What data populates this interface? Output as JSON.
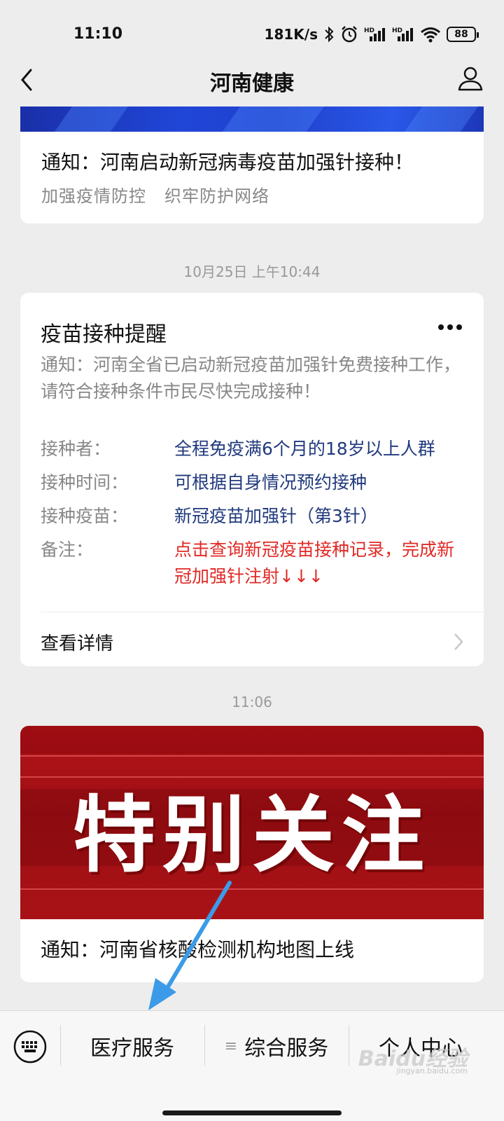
{
  "status_bar": {
    "time": "11:10",
    "network_speed": "181K/s",
    "battery": "88",
    "icons": [
      "bluetooth-icon",
      "alarm-icon",
      "hd-signal-icon",
      "hd-signal-icon",
      "wifi-icon",
      "battery-icon"
    ]
  },
  "header": {
    "title": "河南健康"
  },
  "card1": {
    "headline": "通知：河南启动新冠病毒疫苗加强针接种！",
    "sub1": "加强疫情防控",
    "sub2": "织牢防护网络"
  },
  "timestamp1": "10月25日 上午10:44",
  "card2": {
    "title": "疫苗接种提醒",
    "description": "通知：河南全省已启动新冠疫苗加强针免费接种工作，请符合接种条件市民尽快完成接种！",
    "fields": [
      {
        "label": "接种者：",
        "value": "全程免疫满6个月的18岁以上人群"
      },
      {
        "label": "接种时间：",
        "value": "可根据自身情况预约接种"
      },
      {
        "label": "接种疫苗：",
        "value": "新冠疫苗加强针（第3针）"
      },
      {
        "label": "备注：",
        "value": "点击查询新冠疫苗接种记录，完成新冠加强针注射↓↓↓"
      }
    ],
    "detail_link": "查看详情"
  },
  "timestamp2": "11:06",
  "card3": {
    "banner_text": "特别关注",
    "title": "通知：河南省核酸检测机构地图上线"
  },
  "bottom_menu": {
    "items": [
      "医疗服务",
      "综合服务",
      "个人中心"
    ]
  },
  "watermark": {
    "brand": "Baidu经验",
    "url": "jingyan.baidu.com"
  },
  "colors": {
    "value_blue": "#213a7e",
    "value_red": "#e02a26",
    "annotation_arrow": "#3b9be8"
  }
}
